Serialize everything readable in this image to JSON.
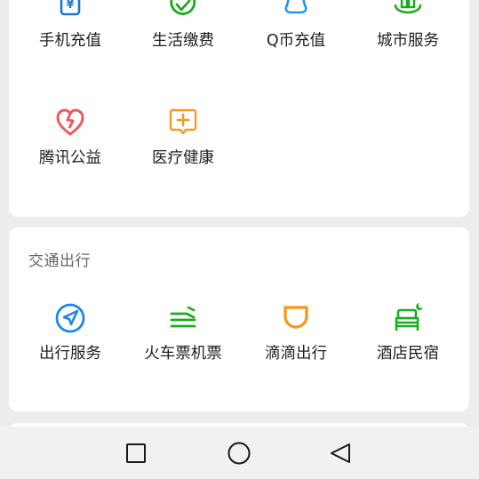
{
  "services_card": {
    "items": [
      {
        "label": "手机充值",
        "icon": "phone-recharge-icon",
        "color": "#1976d2"
      },
      {
        "label": "生活缴费",
        "icon": "utility-bill-icon",
        "color": "#1aad19"
      },
      {
        "label": "Q币充值",
        "icon": "penguin-icon",
        "color": "#2196f3"
      },
      {
        "label": "城市服务",
        "icon": "city-service-icon",
        "color": "#1aad19"
      },
      {
        "label": "腾讯公益",
        "icon": "charity-heart-icon",
        "color": "#f05a5a"
      },
      {
        "label": "医疗健康",
        "icon": "medical-icon",
        "color": "#f59a23"
      }
    ]
  },
  "transport_card": {
    "title": "交通出行",
    "items": [
      {
        "label": "出行服务",
        "icon": "navigation-arrow-icon",
        "color": "#1e88e5"
      },
      {
        "label": "火车票机票",
        "icon": "train-icon",
        "color": "#1aad19"
      },
      {
        "label": "滴滴出行",
        "icon": "didi-icon",
        "color": "#f59a23"
      },
      {
        "label": "酒店民宿",
        "icon": "hotel-bed-icon",
        "color": "#1aad19"
      }
    ]
  },
  "nav_bar": {
    "buttons": [
      "recent-apps-square-icon",
      "home-circle-icon",
      "back-triangle-icon"
    ]
  }
}
